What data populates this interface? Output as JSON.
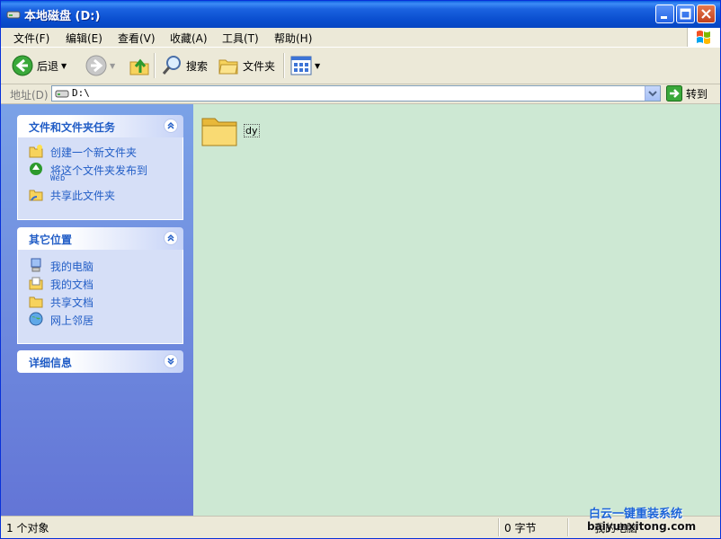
{
  "window": {
    "title": "本地磁盘  (D:)"
  },
  "menu": [
    "文件(F)",
    "编辑(E)",
    "查看(V)",
    "收藏(A)",
    "工具(T)",
    "帮助(H)"
  ],
  "toolbar": {
    "back_label": "后退",
    "search_label": "搜索",
    "folders_label": "文件夹"
  },
  "address": {
    "label": "地址(D)",
    "value": "D:\\",
    "go_label": "转到"
  },
  "taskpane": {
    "file_tasks": {
      "title": "文件和文件夹任务",
      "items": [
        {
          "label": "创建一个新文件夹",
          "icon": "new-folder-icon"
        },
        {
          "label": "将这个文件夹发布到",
          "label2": "Web",
          "icon": "publish-web-icon"
        },
        {
          "label": "共享此文件夹",
          "icon": "share-folder-icon"
        }
      ]
    },
    "other_places": {
      "title": "其它位置",
      "items": [
        {
          "label": "我的电脑",
          "icon": "computer-icon"
        },
        {
          "label": "我的文档",
          "icon": "documents-icon"
        },
        {
          "label": "共享文档",
          "icon": "shared-docs-icon"
        },
        {
          "label": "网上邻居",
          "icon": "network-icon"
        }
      ]
    },
    "details": {
      "title": "详细信息"
    }
  },
  "files": [
    {
      "name": "dy",
      "icon": "folder-icon"
    }
  ],
  "status": {
    "objects": "1 个对象",
    "size": "0 字节",
    "location": "我的电脑"
  },
  "watermark": {
    "line1": "白云一键重装系统",
    "line2": "baiyunxitong.com"
  },
  "colors": {
    "title_bar": "#0a4ecf",
    "task_pane": "#6375d6",
    "main_bg": "#cde8d3",
    "link": "#215dc6"
  }
}
